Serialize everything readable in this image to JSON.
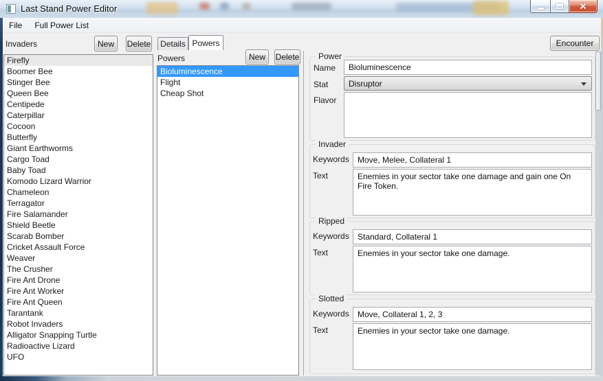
{
  "window": {
    "title": "Last Stand Power Editor"
  },
  "menu": {
    "file": "File",
    "full_power_list": "Full Power List"
  },
  "invaders_panel": {
    "label": "Invaders",
    "new_label": "New",
    "delete_label": "Delete",
    "selected_item": "Firefly",
    "items": [
      "Firefly",
      "Boomer Bee",
      "Stinger Bee",
      "Queen Bee",
      "Centipede",
      "Caterpillar",
      "Cocoon",
      "Butterfly",
      "Giant Earthworms",
      "Cargo Toad",
      "Baby Toad",
      "Komodo Lizard Warrior",
      "Chameleon",
      "Terragator",
      "Fire Salamander",
      "Shield Beetle",
      "Scarab Bomber",
      "Cricket Assault Force",
      "Weaver",
      "The Crusher",
      "Fire Ant Drone",
      "Fire Ant Worker",
      "Fire Ant Queen",
      "Tarantank",
      "Robot Invaders",
      "Alligator Snapping Turtle",
      "Radioactive Lizard",
      "UFO"
    ]
  },
  "tabs": {
    "details": "Details",
    "powers": "Powers",
    "active": "Powers"
  },
  "powers_panel": {
    "label": "Powers",
    "new_label": "New",
    "delete_label": "Delete",
    "selected_item": "Bioluminescence",
    "items": [
      "Bioluminescence",
      "Flight",
      "Cheap Shot"
    ]
  },
  "encounter_button": "Encounter",
  "power_group": {
    "title": "Power",
    "name_label": "Name",
    "name_value": "Bioluminescence",
    "stat_label": "Stat",
    "stat_value": "Disruptor",
    "flavor_label": "Flavor",
    "flavor_value": ""
  },
  "invader_group": {
    "title": "Invader",
    "keywords_label": "Keywords",
    "keywords_value": "Move, Melee, Collateral 1",
    "text_label": "Text",
    "text_value": "Enemies in your sector take one damage and gain one On Fire Token."
  },
  "ripped_group": {
    "title": "Ripped",
    "keywords_label": "Keywords",
    "keywords_value": "Standard, Collateral 1",
    "text_label": "Text",
    "text_value": "Enemies in your sector take one damage."
  },
  "slotted_group": {
    "title": "Slotted",
    "keywords_label": "Keywords",
    "keywords_value": "Move, Collateral 1, 2, 3",
    "text_label": "Text",
    "text_value": "Enemies in your sector take one damage."
  },
  "colors": {
    "active_selection": "#3399ff",
    "inactive_selection": "#e9e9e9",
    "close_button_red": "#c94f32",
    "client_background": "#f0f0f0",
    "window_border_navy": "#163254"
  }
}
